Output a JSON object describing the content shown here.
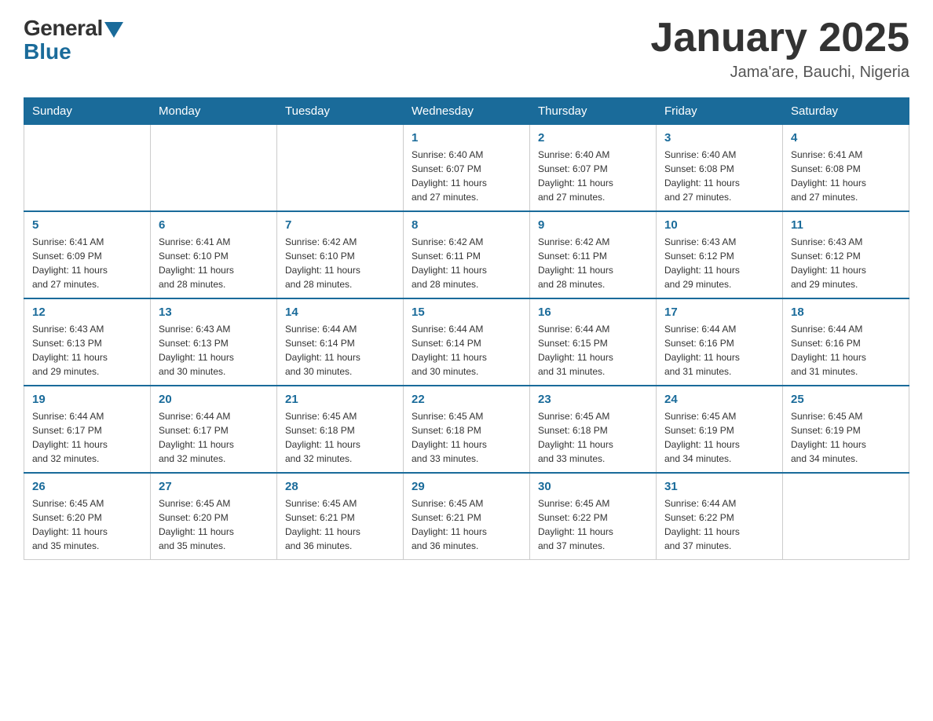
{
  "header": {
    "logo_general": "General",
    "logo_blue": "Blue",
    "month_title": "January 2025",
    "location": "Jama'are, Bauchi, Nigeria"
  },
  "days_of_week": [
    "Sunday",
    "Monday",
    "Tuesday",
    "Wednesday",
    "Thursday",
    "Friday",
    "Saturday"
  ],
  "weeks": [
    [
      {
        "day": "",
        "info": ""
      },
      {
        "day": "",
        "info": ""
      },
      {
        "day": "",
        "info": ""
      },
      {
        "day": "1",
        "info": "Sunrise: 6:40 AM\nSunset: 6:07 PM\nDaylight: 11 hours\nand 27 minutes."
      },
      {
        "day": "2",
        "info": "Sunrise: 6:40 AM\nSunset: 6:07 PM\nDaylight: 11 hours\nand 27 minutes."
      },
      {
        "day": "3",
        "info": "Sunrise: 6:40 AM\nSunset: 6:08 PM\nDaylight: 11 hours\nand 27 minutes."
      },
      {
        "day": "4",
        "info": "Sunrise: 6:41 AM\nSunset: 6:08 PM\nDaylight: 11 hours\nand 27 minutes."
      }
    ],
    [
      {
        "day": "5",
        "info": "Sunrise: 6:41 AM\nSunset: 6:09 PM\nDaylight: 11 hours\nand 27 minutes."
      },
      {
        "day": "6",
        "info": "Sunrise: 6:41 AM\nSunset: 6:10 PM\nDaylight: 11 hours\nand 28 minutes."
      },
      {
        "day": "7",
        "info": "Sunrise: 6:42 AM\nSunset: 6:10 PM\nDaylight: 11 hours\nand 28 minutes."
      },
      {
        "day": "8",
        "info": "Sunrise: 6:42 AM\nSunset: 6:11 PM\nDaylight: 11 hours\nand 28 minutes."
      },
      {
        "day": "9",
        "info": "Sunrise: 6:42 AM\nSunset: 6:11 PM\nDaylight: 11 hours\nand 28 minutes."
      },
      {
        "day": "10",
        "info": "Sunrise: 6:43 AM\nSunset: 6:12 PM\nDaylight: 11 hours\nand 29 minutes."
      },
      {
        "day": "11",
        "info": "Sunrise: 6:43 AM\nSunset: 6:12 PM\nDaylight: 11 hours\nand 29 minutes."
      }
    ],
    [
      {
        "day": "12",
        "info": "Sunrise: 6:43 AM\nSunset: 6:13 PM\nDaylight: 11 hours\nand 29 minutes."
      },
      {
        "day": "13",
        "info": "Sunrise: 6:43 AM\nSunset: 6:13 PM\nDaylight: 11 hours\nand 30 minutes."
      },
      {
        "day": "14",
        "info": "Sunrise: 6:44 AM\nSunset: 6:14 PM\nDaylight: 11 hours\nand 30 minutes."
      },
      {
        "day": "15",
        "info": "Sunrise: 6:44 AM\nSunset: 6:14 PM\nDaylight: 11 hours\nand 30 minutes."
      },
      {
        "day": "16",
        "info": "Sunrise: 6:44 AM\nSunset: 6:15 PM\nDaylight: 11 hours\nand 31 minutes."
      },
      {
        "day": "17",
        "info": "Sunrise: 6:44 AM\nSunset: 6:16 PM\nDaylight: 11 hours\nand 31 minutes."
      },
      {
        "day": "18",
        "info": "Sunrise: 6:44 AM\nSunset: 6:16 PM\nDaylight: 11 hours\nand 31 minutes."
      }
    ],
    [
      {
        "day": "19",
        "info": "Sunrise: 6:44 AM\nSunset: 6:17 PM\nDaylight: 11 hours\nand 32 minutes."
      },
      {
        "day": "20",
        "info": "Sunrise: 6:44 AM\nSunset: 6:17 PM\nDaylight: 11 hours\nand 32 minutes."
      },
      {
        "day": "21",
        "info": "Sunrise: 6:45 AM\nSunset: 6:18 PM\nDaylight: 11 hours\nand 32 minutes."
      },
      {
        "day": "22",
        "info": "Sunrise: 6:45 AM\nSunset: 6:18 PM\nDaylight: 11 hours\nand 33 minutes."
      },
      {
        "day": "23",
        "info": "Sunrise: 6:45 AM\nSunset: 6:18 PM\nDaylight: 11 hours\nand 33 minutes."
      },
      {
        "day": "24",
        "info": "Sunrise: 6:45 AM\nSunset: 6:19 PM\nDaylight: 11 hours\nand 34 minutes."
      },
      {
        "day": "25",
        "info": "Sunrise: 6:45 AM\nSunset: 6:19 PM\nDaylight: 11 hours\nand 34 minutes."
      }
    ],
    [
      {
        "day": "26",
        "info": "Sunrise: 6:45 AM\nSunset: 6:20 PM\nDaylight: 11 hours\nand 35 minutes."
      },
      {
        "day": "27",
        "info": "Sunrise: 6:45 AM\nSunset: 6:20 PM\nDaylight: 11 hours\nand 35 minutes."
      },
      {
        "day": "28",
        "info": "Sunrise: 6:45 AM\nSunset: 6:21 PM\nDaylight: 11 hours\nand 36 minutes."
      },
      {
        "day": "29",
        "info": "Sunrise: 6:45 AM\nSunset: 6:21 PM\nDaylight: 11 hours\nand 36 minutes."
      },
      {
        "day": "30",
        "info": "Sunrise: 6:45 AM\nSunset: 6:22 PM\nDaylight: 11 hours\nand 37 minutes."
      },
      {
        "day": "31",
        "info": "Sunrise: 6:44 AM\nSunset: 6:22 PM\nDaylight: 11 hours\nand 37 minutes."
      },
      {
        "day": "",
        "info": ""
      }
    ]
  ]
}
